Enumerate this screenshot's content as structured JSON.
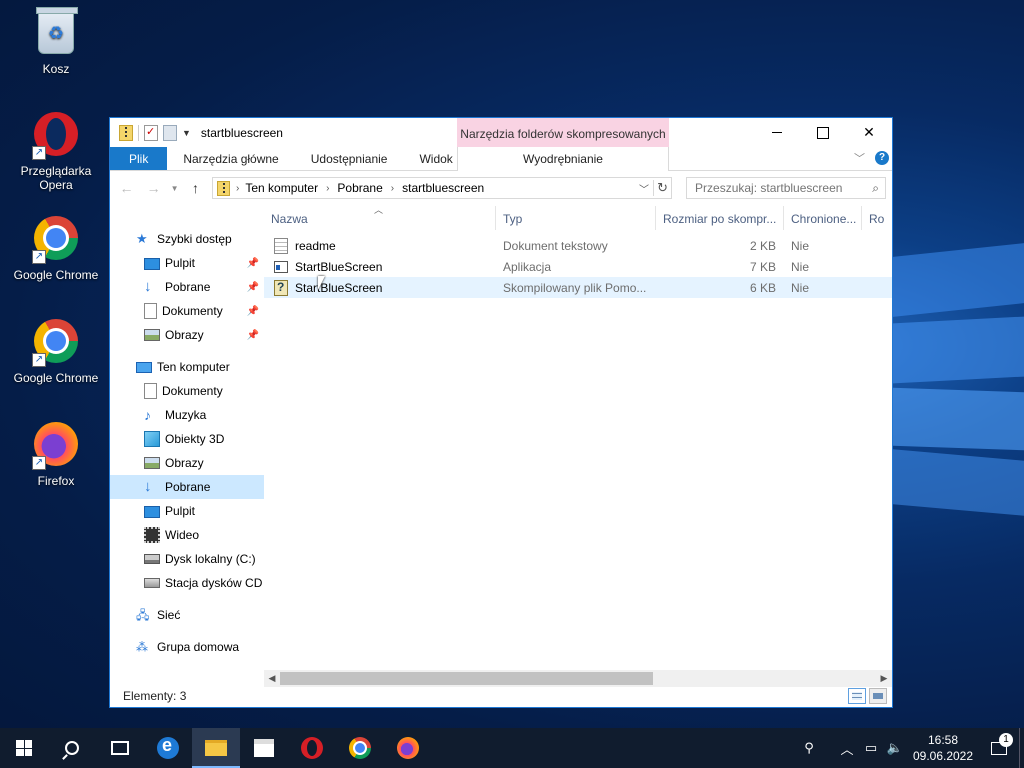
{
  "desktop": {
    "icons": [
      {
        "label": "Kosz"
      },
      {
        "label": "Przeglądarka Opera"
      },
      {
        "label": "Google Chrome"
      },
      {
        "label": "Google Chrome"
      },
      {
        "label": "Firefox"
      }
    ]
  },
  "window": {
    "title": "startbluescreen",
    "context_tab_group": "Narzędzia folderów skompresowanych",
    "ribbon_tabs": {
      "file": "Plik",
      "home": "Narzędzia główne",
      "share": "Udostępnianie",
      "view": "Widok",
      "extract": "Wyodrębnianie"
    },
    "address": {
      "crumbs": [
        "Ten komputer",
        "Pobrane",
        "startbluescreen"
      ]
    },
    "search": {
      "placeholder": "Przeszukaj: startbluescreen"
    },
    "nav": {
      "quick_access": "Szybki dostęp",
      "quick_items": [
        {
          "label": "Pulpit",
          "icon": "desktop-icon"
        },
        {
          "label": "Pobrane",
          "icon": "download-icon"
        },
        {
          "label": "Dokumenty",
          "icon": "documents-icon"
        },
        {
          "label": "Obrazy",
          "icon": "pictures-icon"
        }
      ],
      "this_pc": "Ten komputer",
      "pc_items": [
        {
          "label": "Dokumenty",
          "icon": "documents-icon"
        },
        {
          "label": "Muzyka",
          "icon": "music-icon"
        },
        {
          "label": "Obiekty 3D",
          "icon": "3d-objects-icon"
        },
        {
          "label": "Obrazy",
          "icon": "pictures-icon"
        },
        {
          "label": "Pobrane",
          "icon": "download-icon"
        },
        {
          "label": "Pulpit",
          "icon": "desktop-icon"
        },
        {
          "label": "Wideo",
          "icon": "video-icon"
        },
        {
          "label": "Dysk lokalny (C:)",
          "icon": "local-disk-icon"
        },
        {
          "label": "Stacja dysków CD (I",
          "icon": "cd-drive-icon"
        }
      ],
      "network": "Sieć",
      "homegroup": "Grupa domowa"
    },
    "columns": {
      "name": "Nazwa",
      "type": "Typ",
      "size": "Rozmiar po skompr...",
      "protected": "Chronione...",
      "ratio": "Ro"
    },
    "files": [
      {
        "name": "readme",
        "type": "Dokument tekstowy",
        "size": "2 KB",
        "protected": "Nie",
        "icon": "text-file-icon"
      },
      {
        "name": "StartBlueScreen",
        "type": "Aplikacja",
        "size": "7 KB",
        "protected": "Nie",
        "icon": "application-icon"
      },
      {
        "name": "StartBlueScreen",
        "type": "Skompilowany plik Pomo...",
        "size": "6 KB",
        "protected": "Nie",
        "icon": "help-file-icon"
      }
    ],
    "status": "Elementy: 3"
  },
  "taskbar": {
    "clock_time": "16:58",
    "clock_date": "09.06.2022",
    "notification_count": "1"
  }
}
